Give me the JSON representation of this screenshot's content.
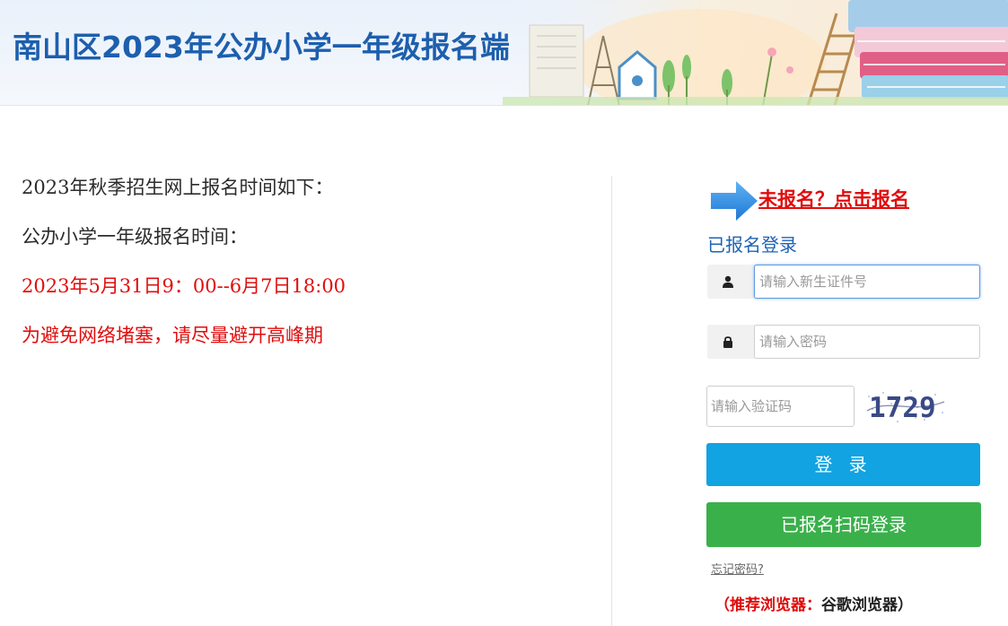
{
  "header": {
    "title": "南山区2023年公办小学一年级报名端"
  },
  "notice": {
    "line1": "2023年秋季招生网上报名时间如下：",
    "line2": "公办小学一年级报名时间：",
    "line3": "2023年5月31日9：00--6月7日18:00",
    "line4": "为避免网络堵塞，请尽量避开高峰期"
  },
  "login": {
    "register_link": "未报名？点击报名",
    "heading": "已报名登录",
    "id_placeholder": "请输入新生证件号",
    "password_placeholder": "请输入密码",
    "captcha_placeholder": "请输入验证码",
    "captcha_code": "1729",
    "login_button": "登 录",
    "qr_login_button": "已报名扫码登录",
    "forgot_password": "忘记密码?",
    "browser_tip_prefix": "（推荐浏览器：",
    "browser_tip_name": "谷歌浏览器）"
  },
  "colors": {
    "title_blue": "#1d5fad",
    "notice_red": "#e10d0d",
    "login_button": "#11a3e2",
    "qr_button": "#3ab04b"
  },
  "icons": {
    "user": "user-icon",
    "password": "lock-icon",
    "arrow": "arrow-right-icon"
  }
}
